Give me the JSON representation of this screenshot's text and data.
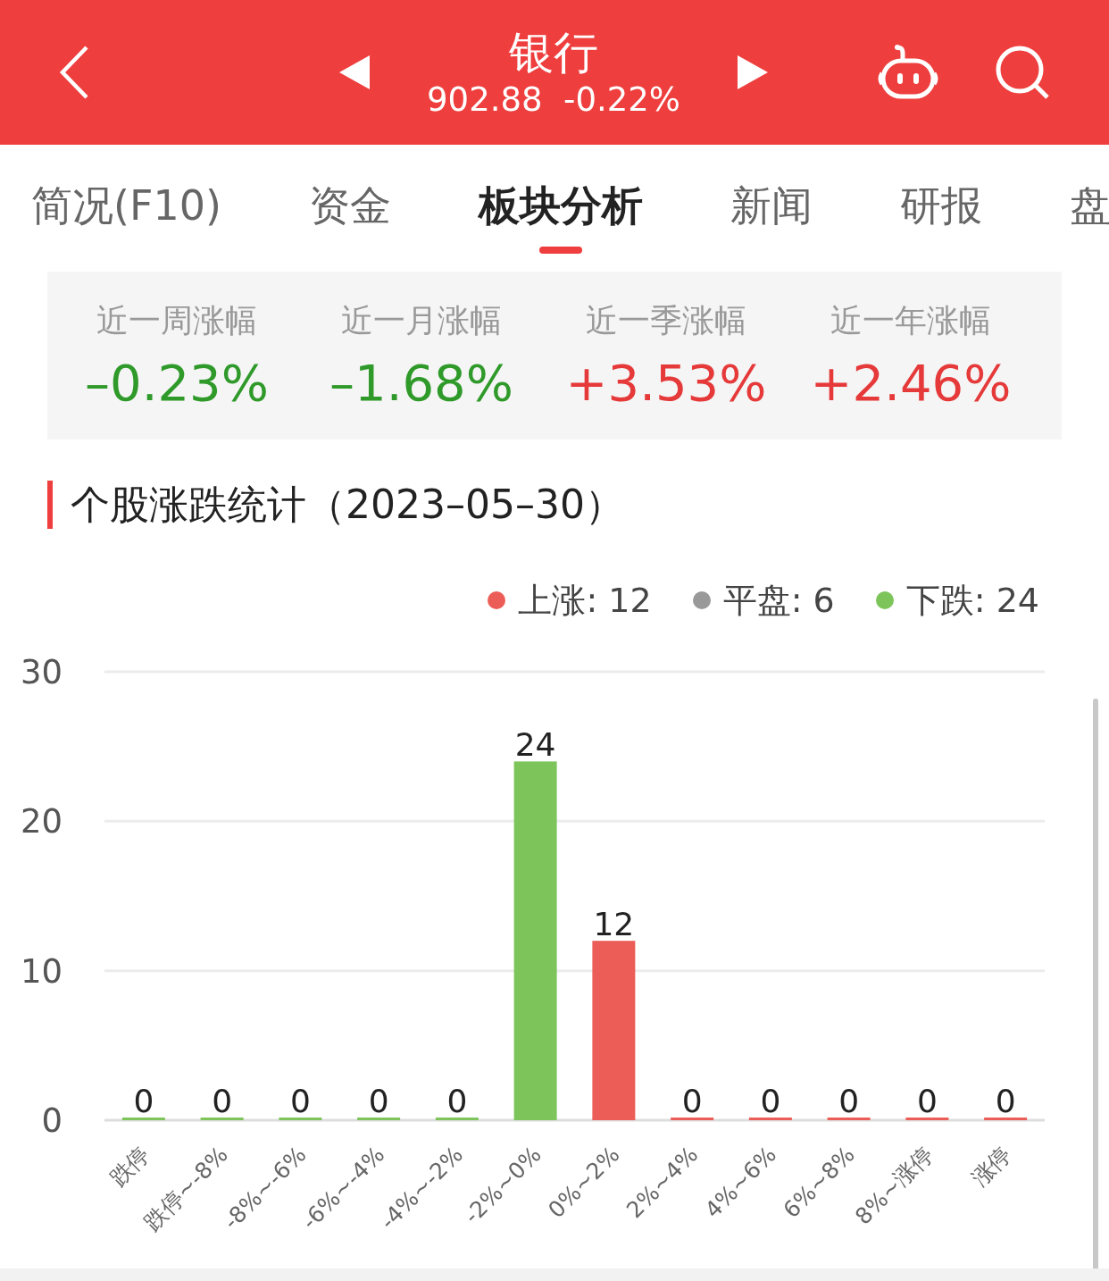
{
  "header": {
    "title": "银行",
    "quote": "902.88  -0.22%"
  },
  "tabs": [
    {
      "label": "简况(F10)",
      "selected": false
    },
    {
      "label": "资金",
      "selected": false
    },
    {
      "label": "板块分析",
      "selected": true
    },
    {
      "label": "新闻",
      "selected": false
    },
    {
      "label": "研报",
      "selected": false
    },
    {
      "label": "盘",
      "selected": false
    }
  ],
  "stats": [
    {
      "label": "近一周涨幅",
      "value": "–0.23%",
      "color": "#2f9a2a"
    },
    {
      "label": "近一月涨幅",
      "value": "–1.68%",
      "color": "#2f9a2a"
    },
    {
      "label": "近一季涨幅",
      "value": "+3.53%",
      "color": "#e5393a"
    },
    {
      "label": "近一年涨幅",
      "value": "+2.46%",
      "color": "#e5393a"
    }
  ],
  "section": {
    "title": "个股涨跌统计（2023–05–30）"
  },
  "legend": [
    {
      "label": "上涨: 12",
      "color": "#ec5d57"
    },
    {
      "label": "平盘: 6",
      "color": "#999999"
    },
    {
      "label": "下跌: 24",
      "color": "#7dc55b"
    }
  ],
  "chart_data": {
    "type": "bar",
    "categories": [
      "跌停",
      "跌停~-8%",
      "-8%~-6%",
      "-6%~-4%",
      "-4%~-2%",
      "-2%~0%",
      "0%~2%",
      "2%~4%",
      "4%~6%",
      "6%~8%",
      "8%~涨停",
      "涨停"
    ],
    "series": [
      {
        "color": "#7dc55b",
        "values": [
          0,
          0,
          0,
          0,
          0,
          24,
          null,
          null,
          null,
          null,
          null,
          null
        ]
      },
      {
        "color": "#ec5d57",
        "values": [
          null,
          null,
          null,
          null,
          null,
          null,
          12,
          0,
          0,
          0,
          0,
          0
        ]
      }
    ],
    "stacked": true,
    "ylim": [
      0,
      30
    ],
    "yticks": [
      0,
      10,
      20,
      30
    ],
    "data_labels": true
  }
}
